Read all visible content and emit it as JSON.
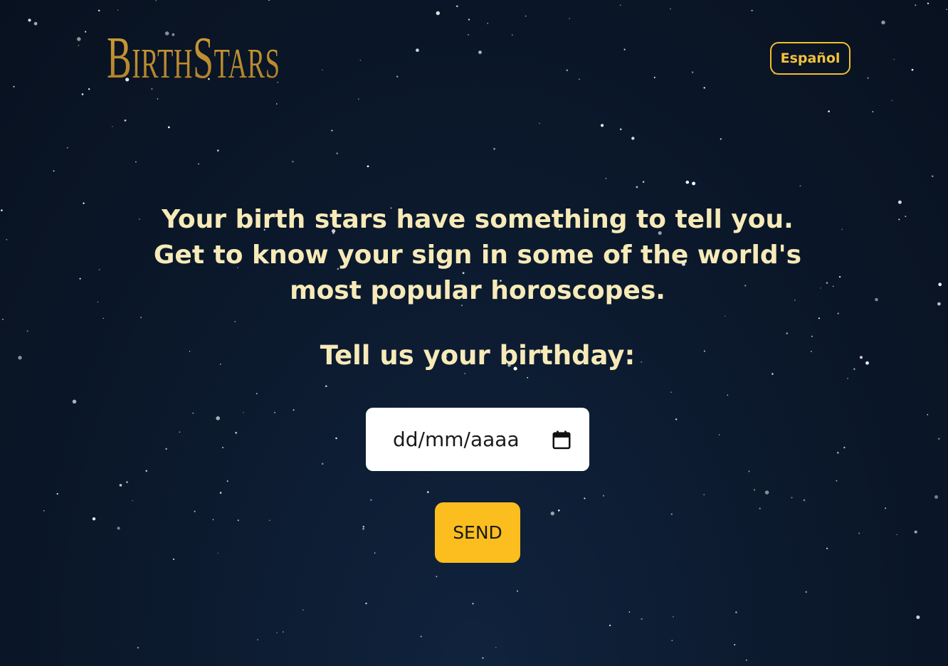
{
  "header": {
    "logo_text": "BirthStars",
    "language_button": "Español"
  },
  "main": {
    "headline_line1": "Your birth stars have something to tell you.",
    "headline_line2": "Get to know your sign in some of the world's most popular horoscopes.",
    "prompt": "Tell us your birthday:",
    "date_input": {
      "placeholder": "dd/mm/aaaa",
      "value": ""
    },
    "send_label": "SEND"
  },
  "colors": {
    "background": "#0c1a2e",
    "logo_gold": "#b88b2c",
    "accent_yellow": "#fbbe1e",
    "text_cream": "#f6eab8"
  },
  "icons": {
    "date_input_icon": "calendar-icon"
  }
}
